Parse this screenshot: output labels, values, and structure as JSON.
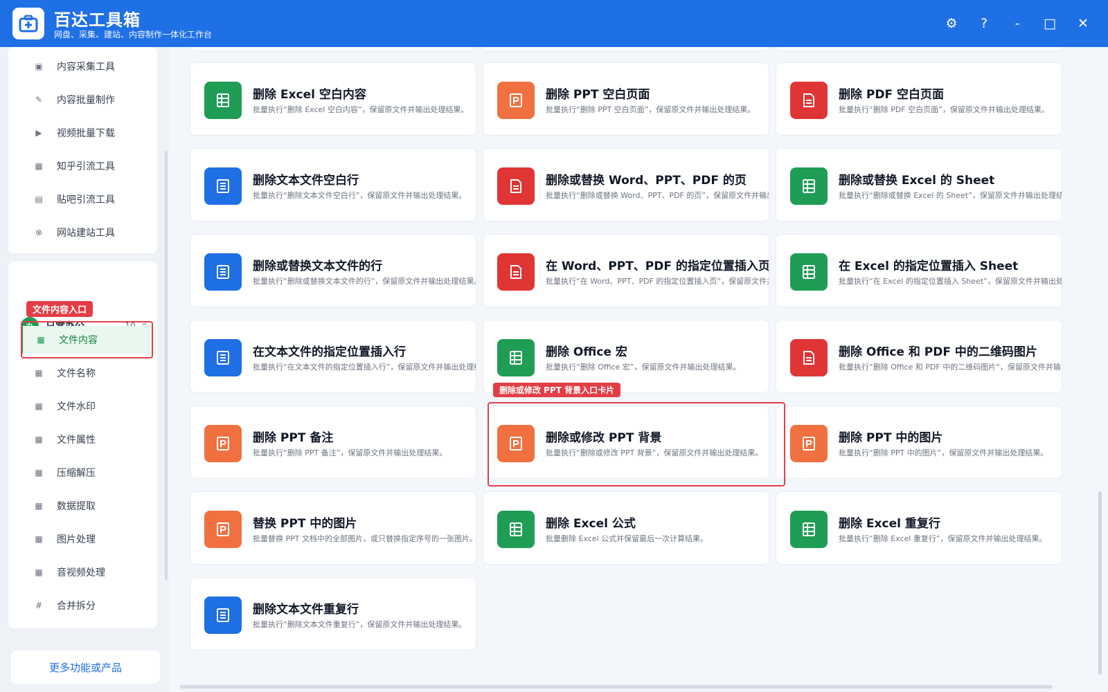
{
  "app": {
    "name": "百达工具箱",
    "subtitle": "网盘、采集、建站、内容制作一体化工作台",
    "controls": {
      "settings": "⚙",
      "help": "?",
      "minimize": "-",
      "maximize": "□",
      "close": "✕"
    }
  },
  "sidebar": {
    "top_items": [
      {
        "label": "内容采集工具",
        "icon": "collect-icon"
      },
      {
        "label": "内容批量制作",
        "icon": "pen-icon"
      },
      {
        "label": "视频批量下载",
        "icon": "video-icon"
      },
      {
        "label": "知乎引流工具",
        "icon": "zhihu-icon"
      },
      {
        "label": "贴吧引流工具",
        "icon": "tieba-icon"
      },
      {
        "label": "网站建站工具",
        "icon": "website-icon"
      }
    ],
    "section": {
      "icon_text": "办",
      "title": "日常办公",
      "count": "10",
      "caret": "^"
    },
    "items": [
      {
        "label": "文件内容",
        "active": true
      },
      {
        "label": "文件名称"
      },
      {
        "label": "文件水印"
      },
      {
        "label": "文件属性"
      },
      {
        "label": "压缩解压"
      },
      {
        "label": "数据提取"
      },
      {
        "label": "图片处理"
      },
      {
        "label": "音视频处理"
      },
      {
        "label": "合并拆分",
        "icon": "hash-icon"
      }
    ],
    "annotation": "文件内容入口",
    "more_button": "更多功能或产品"
  },
  "cards": [
    {
      "title": "删除 Excel 空白内容",
      "desc": "批量执行“删除 Excel 空白内容”，保留原文件并输出处理结果。",
      "type": "excel"
    },
    {
      "title": "删除 PPT 空白页面",
      "desc": "批量执行“删除 PPT 空白页面”，保留原文件并输出处理结果。",
      "type": "ppt"
    },
    {
      "title": "删除 PDF 空白页面",
      "desc": "批量执行“删除 PDF 空白页面”，保留原文件并输出处理结果。",
      "type": "pdf"
    },
    {
      "title": "删除文本文件空白行",
      "desc": "批量执行“删除文本文件空白行”，保留原文件并输出处理结果。",
      "type": "text"
    },
    {
      "title": "删除或替换 Word、PPT、PDF 的页",
      "desc": "批量执行“删除或替换 Word、PPT、PDF 的页”，保留原文件并输出处理结果。",
      "type": "pdf"
    },
    {
      "title": "删除或替换 Excel 的 Sheet",
      "desc": "批量执行“删除或替换 Excel 的 Sheet”，保留原文件并输出处理结果。",
      "type": "excel"
    },
    {
      "title": "删除或替换文本文件的行",
      "desc": "批量执行“删除或替换文本文件的行”，保留原文件并输出处理结果。",
      "type": "text"
    },
    {
      "title": "在 Word、PPT、PDF 的指定位置插入页",
      "desc": "批量执行“在 Word、PPT、PDF 的指定位置插入页”，保留原文件并输出处理结果。",
      "type": "pdf"
    },
    {
      "title": "在 Excel 的指定位置插入 Sheet",
      "desc": "批量执行“在 Excel 的指定位置插入 Sheet”，保留原文件并输出处理结果。",
      "type": "excel"
    },
    {
      "title": "在文本文件的指定位置插入行",
      "desc": "批量执行“在文本文件的指定位置插入行”，保留原文件并输出处理结果。",
      "type": "text"
    },
    {
      "title": "删除 Office 宏",
      "desc": "批量执行“删除 Office 宏”，保留原文件并输出处理结果。",
      "type": "excel"
    },
    {
      "title": "删除 Office 和 PDF 中的二维码图片",
      "desc": "批量执行“删除 Office 和 PDF 中的二维码图片”，保留原文件并输出处理结果。",
      "type": "pdf"
    },
    {
      "title": "删除 PPT 备注",
      "desc": "批量执行“删除 PPT 备注”，保留原文件并输出处理结果。",
      "type": "ppt"
    },
    {
      "title": "删除或修改 PPT 背景",
      "desc": "批量执行“删除或修改 PPT 背景”，保留原文件并输出处理结果。",
      "type": "ppt"
    },
    {
      "title": "删除 PPT 中的图片",
      "desc": "批量执行“删除 PPT 中的图片”，保留原文件并输出处理结果。",
      "type": "ppt"
    },
    {
      "title": "替换 PPT 中的图片",
      "desc": "批量替换 PPT 文档中的全部图片，或只替换指定序号的一张图片。",
      "type": "ppt"
    },
    {
      "title": "删除 Excel 公式",
      "desc": "批量删除 Excel 公式并保留最后一次计算结果。",
      "type": "excel"
    },
    {
      "title": "删除 Excel 重复行",
      "desc": "批量执行“删除 Excel 重复行”，保留原文件并输出处理结果。",
      "type": "excel"
    },
    {
      "title": "删除文本文件重复行",
      "desc": "批量执行“删除文本文件重复行”，保留原文件并输出处理结果。",
      "type": "text"
    }
  ],
  "card_annotation": "删除或修改 PPT 背景入口卡片",
  "colors": {
    "excel": "#1f9d55",
    "ppt": "#f07040",
    "pdf": "#e03535",
    "text": "#1f6fe5",
    "accent": "#1f6fe5",
    "highlight": "#e33e46"
  }
}
